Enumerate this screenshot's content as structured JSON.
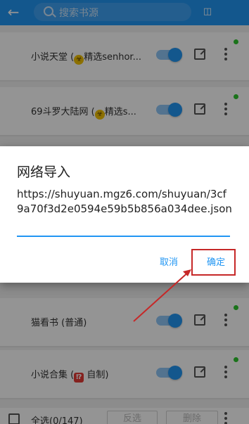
{
  "toolbar": {
    "back_icon": "arrow-back-icon",
    "search_placeholder": "搜索书源",
    "group_icon": "group-icon"
  },
  "sources": [
    {
      "name": "小说天堂 (",
      "badge": "☣",
      "suffix": "精选senhor..."
    },
    {
      "name": "69斗罗大陆网 (",
      "badge": "☣",
      "suffix": "精选s..."
    },
    {
      "name": "猫看书 (普通)",
      "badge": "",
      "suffix": ""
    },
    {
      "name": "小说合集 (",
      "badge": "⁉",
      "suffix": " 自制)"
    }
  ],
  "bottom": {
    "select_all": "全选(0/147)",
    "invert": "反选",
    "delete": "删除"
  },
  "dialog": {
    "title": "网络导入",
    "url": "https://shuyuan.mgz6.com/shuyuan/3cf9a70f3d2e0594e59b5b856a034dee.json",
    "cancel": "取消",
    "ok": "确定"
  },
  "colors": {
    "primary": "#2196f3",
    "highlight": "#c62828",
    "online_dot": "#2ec62e"
  }
}
